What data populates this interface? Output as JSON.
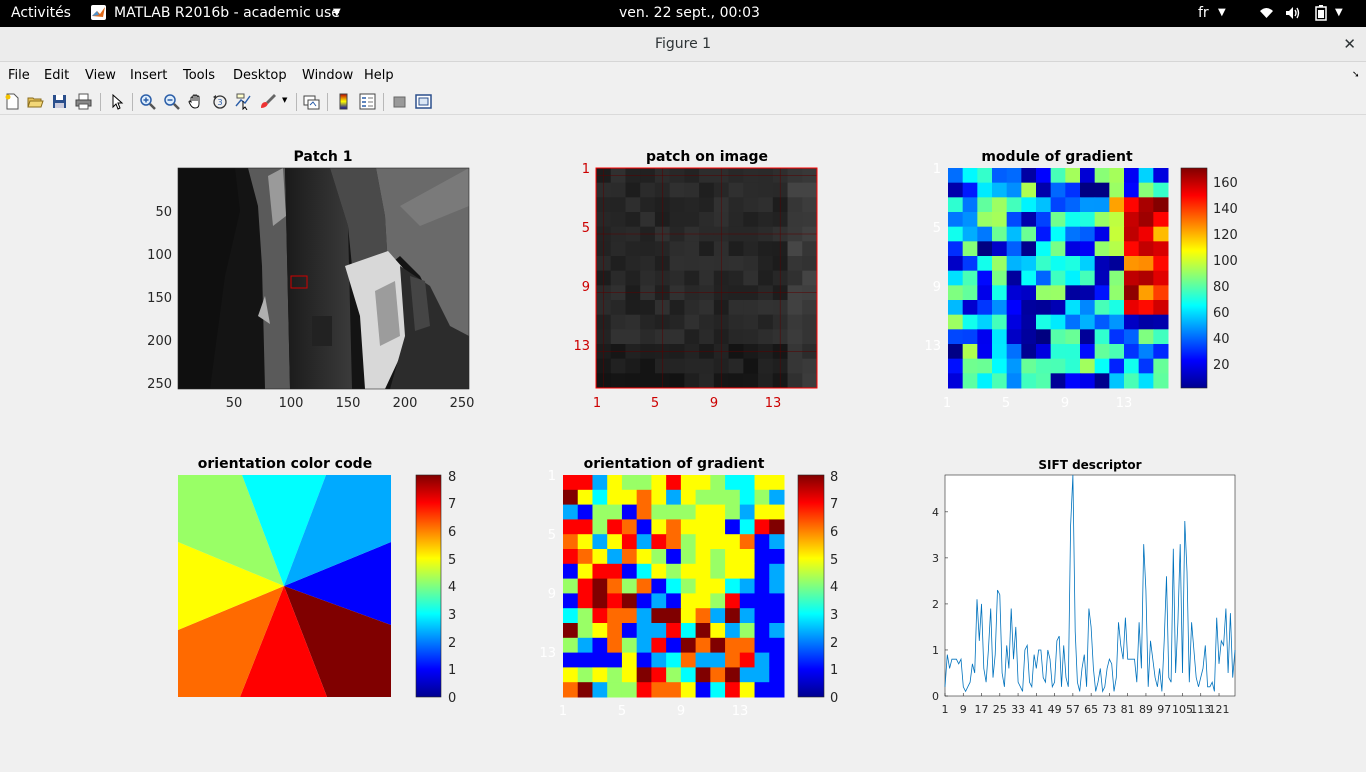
{
  "topbar": {
    "activities": "Activités",
    "app_menu": "MATLAB R2016b - academic use",
    "clock": "ven. 22 sept., 00:03",
    "lang": "fr"
  },
  "window": {
    "title": "Figure 1",
    "close": "✕"
  },
  "menu": [
    "File",
    "Edit",
    "View",
    "Insert",
    "Tools",
    "Desktop",
    "Window",
    "Help"
  ],
  "toolbar_icons": [
    "new-figure-icon",
    "open-file-icon",
    "save-icon",
    "print-icon",
    "pointer-icon",
    "zoom-in-icon",
    "zoom-out-icon",
    "pan-icon",
    "rotate-3d-icon",
    "data-cursor-icon",
    "brush-icon",
    "link-plot-icon",
    "insert-colorbar-icon",
    "insert-legend-icon",
    "hide-plot-tools-icon",
    "show-plot-tools-icon"
  ],
  "axes": {
    "patch1": {
      "title": "Patch 1",
      "xticks": [
        "50",
        "100",
        "150",
        "200",
        "250"
      ],
      "yticks": [
        "50",
        "100",
        "150",
        "200",
        "250"
      ]
    },
    "patch_on_image": {
      "title": "patch on image",
      "xticks": [
        "1",
        "5",
        "9",
        "13"
      ],
      "yticks": [
        "1",
        "5",
        "9",
        "13"
      ]
    },
    "module": {
      "title": "module of gradient",
      "xticks": [
        "1",
        "5",
        "9",
        "13"
      ],
      "yticks": [
        "1",
        "5",
        "9",
        "13"
      ],
      "cbar_ticks": [
        "20",
        "40",
        "60",
        "80",
        "100",
        "120",
        "140",
        "160"
      ]
    },
    "orientation_code": {
      "title": "orientation color code",
      "cbar_ticks": [
        "0",
        "1",
        "2",
        "3",
        "4",
        "5",
        "6",
        "7",
        "8"
      ]
    },
    "orientation": {
      "title": "orientation of gradient",
      "xticks": [
        "1",
        "5",
        "9",
        "13"
      ],
      "yticks": [
        "1",
        "5",
        "9",
        "13"
      ],
      "cbar_ticks": [
        "0",
        "1",
        "2",
        "3",
        "4",
        "5",
        "6",
        "7",
        "8"
      ]
    },
    "sift": {
      "title": "SIFT descriptor"
    }
  },
  "chart_data": {
    "type": "line",
    "title": "SIFT descriptor",
    "xlabel": "",
    "ylabel": "",
    "xlim": [
      1,
      128
    ],
    "ylim": [
      0,
      4.8
    ],
    "xticks": [
      "1",
      "9",
      "17",
      "25",
      "33",
      "41",
      "49",
      "57",
      "65",
      "73",
      "81",
      "89",
      "97",
      "105",
      "113",
      "121"
    ],
    "yticks": [
      "0",
      "1",
      "2",
      "3",
      "4"
    ],
    "color": "#0072bd",
    "values": [
      0.2,
      0.9,
      0.6,
      0.8,
      0.8,
      0.8,
      0.7,
      0.8,
      0.2,
      0.1,
      0.2,
      0.3,
      0.7,
      0.5,
      2.1,
      1.2,
      2.0,
      0.6,
      0.3,
      1.0,
      1.9,
      0.4,
      0.9,
      2.3,
      2.2,
      0.5,
      0.2,
      1.1,
      0.6,
      1.9,
      0.8,
      1.5,
      0.3,
      0.2,
      0.1,
      1.0,
      1.1,
      0.3,
      0.2,
      0.9,
      0.6,
      1.0,
      1.0,
      0.4,
      0.3,
      1.0,
      0.8,
      0.2,
      0.3,
      1.2,
      1.3,
      0.2,
      1.1,
      0.4,
      0.2,
      3.7,
      4.8,
      1.4,
      0.3,
      0.1,
      0.6,
      0.9,
      0.2,
      1.9,
      1.5,
      0.6,
      0.1,
      0.3,
      0.6,
      0.1,
      0.2,
      0.6,
      0.8,
      0.7,
      0.1,
      0.4,
      1.6,
      1.1,
      0.8,
      1.7,
      0.8,
      0.8,
      0.8,
      0.8,
      0.3,
      1.6,
      0.6,
      3.3,
      2.3,
      0.2,
      1.2,
      0.8,
      0.4,
      0.2,
      0.6,
      0.1,
      1.2,
      2.6,
      0.4,
      0.3,
      3.2,
      0.5,
      1.6,
      3.3,
      0.5,
      3.8,
      2.7,
      0.3,
      1.6,
      1.0,
      0.4,
      0.2,
      0.4,
      0.6,
      1.1,
      0.2,
      0.2,
      0.3,
      0.1,
      1.7,
      0.7,
      1.2,
      1.1,
      1.9,
      0.5,
      1.8,
      0.4,
      1.0
    ]
  }
}
